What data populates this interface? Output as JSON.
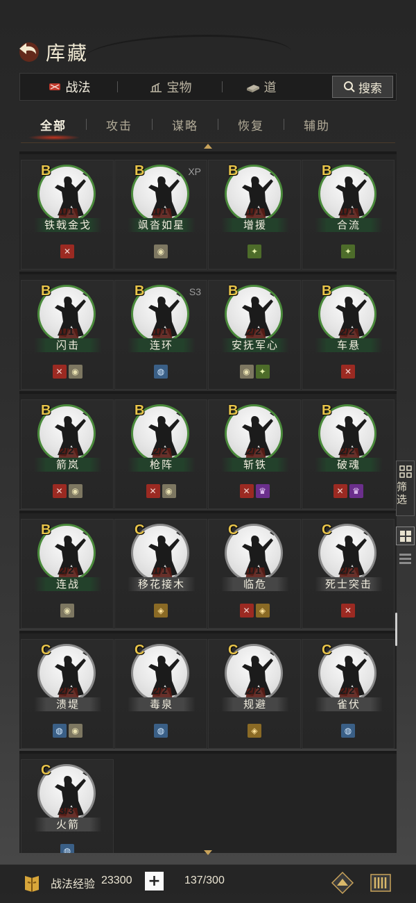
{
  "header": {
    "title": "库藏"
  },
  "main_tabs": [
    {
      "label": "战法",
      "active": true
    },
    {
      "label": "宝物",
      "active": false
    },
    {
      "label": "道",
      "active": false
    }
  ],
  "search": {
    "label": "搜索"
  },
  "sub_tabs": [
    {
      "label": "全部",
      "active": true
    },
    {
      "label": "攻击",
      "active": false
    },
    {
      "label": "谋略",
      "active": false
    },
    {
      "label": "恢复",
      "active": false
    },
    {
      "label": "辅助",
      "active": false
    }
  ],
  "cards": [
    {
      "grade": "B",
      "count": "1/1",
      "name": "铁戟金戈",
      "tag": "",
      "badges": [
        "attack"
      ]
    },
    {
      "grade": "B",
      "count": "1/1",
      "name": "飒沓如星",
      "tag": "XP",
      "badges": [
        "heal"
      ]
    },
    {
      "grade": "B",
      "count": "1/1",
      "name": "增援",
      "tag": "",
      "badges": [
        "boost"
      ]
    },
    {
      "grade": "B",
      "count": "1/1",
      "name": "合流",
      "tag": "",
      "badges": [
        "boost"
      ]
    },
    {
      "grade": "B",
      "count": "1/1",
      "name": "闪击",
      "tag": "",
      "badges": [
        "attack",
        "heal"
      ]
    },
    {
      "grade": "B",
      "count": "1/1",
      "name": "连环",
      "tag": "S3",
      "badges": [
        "plan"
      ]
    },
    {
      "grade": "B",
      "count": "2/2",
      "name": "安抚军心",
      "tag": "",
      "badges": [
        "heal",
        "boost"
      ]
    },
    {
      "grade": "B",
      "count": "2/2",
      "name": "车悬",
      "tag": "",
      "badges": [
        "attack"
      ]
    },
    {
      "grade": "B",
      "count": "2/2",
      "name": "箭岚",
      "tag": "",
      "badges": [
        "attack",
        "heal"
      ]
    },
    {
      "grade": "B",
      "count": "2/2",
      "name": "枪阵",
      "tag": "",
      "badges": [
        "attack",
        "heal"
      ]
    },
    {
      "grade": "B",
      "count": "2/2",
      "name": "斩铁",
      "tag": "",
      "badges": [
        "attack",
        "purple"
      ]
    },
    {
      "grade": "B",
      "count": "2/2",
      "name": "破魂",
      "tag": "",
      "badges": [
        "attack",
        "purple"
      ]
    },
    {
      "grade": "B",
      "count": "2/2",
      "name": "连战",
      "tag": "",
      "badges": [
        "heal"
      ]
    },
    {
      "grade": "C",
      "count": "1/1",
      "name": "移花接木",
      "tag": "",
      "badges": [
        "shield"
      ]
    },
    {
      "grade": "C",
      "count": "1/1",
      "name": "临危",
      "tag": "",
      "badges": [
        "attack",
        "shield"
      ]
    },
    {
      "grade": "C",
      "count": "2/2",
      "name": "死士突击",
      "tag": "",
      "badges": [
        "attack"
      ]
    },
    {
      "grade": "C",
      "count": "2/2",
      "name": "溃堤",
      "tag": "",
      "badges": [
        "plan",
        "heal"
      ]
    },
    {
      "grade": "C",
      "count": "2/2",
      "name": "毒泉",
      "tag": "",
      "badges": [
        "plan"
      ]
    },
    {
      "grade": "C",
      "count": "2/2",
      "name": "规避",
      "tag": "",
      "badges": [
        "shield"
      ]
    },
    {
      "grade": "C",
      "count": "2/2",
      "name": "雀伏",
      "tag": "",
      "badges": [
        "plan"
      ]
    },
    {
      "grade": "C",
      "count": "3/3",
      "name": "火箭",
      "tag": "",
      "badges": [
        "plan"
      ]
    }
  ],
  "side": {
    "filter_label": "筛选"
  },
  "bottom": {
    "exp_label": "战法经验",
    "exp_value": "23300",
    "plus": "+",
    "capacity": "137/300"
  },
  "colors": {
    "grade_b_ring": "#4a8a3b",
    "grade_c_ring": "#8a8a8a",
    "grade_text": "#e8c44a"
  }
}
